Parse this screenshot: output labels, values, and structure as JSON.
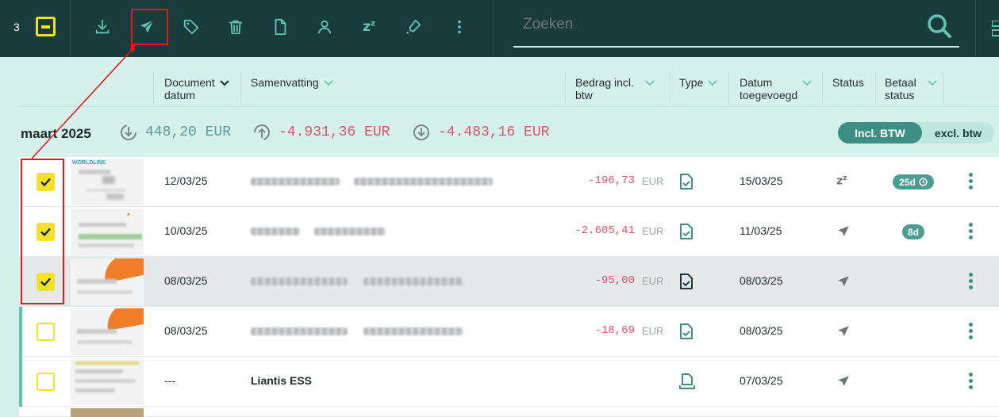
{
  "toolbar": {
    "selected_count": "3",
    "zz_label": "z",
    "zz_sup": "z",
    "search_placeholder": "Zoeken",
    "icons": [
      "checkbox-indeterminate-icon",
      "download-icon",
      "send-icon",
      "tag-icon",
      "trash-icon",
      "file-icon",
      "assign-user-icon",
      "snooze-icon",
      "marker-icon",
      "more-vertical-icon",
      "search-icon"
    ]
  },
  "columns": {
    "doc_date_1": "Document",
    "doc_date_2": "datum",
    "summary": "Samenvatting",
    "amount_1": "Bedrag incl.",
    "amount_2": "btw",
    "type": "Type",
    "added_1": "Datum",
    "added_2": "toegevoegd",
    "status": "Status",
    "pay_1": "Betaal",
    "pay_2": "status"
  },
  "month": {
    "label": "maart 2025",
    "income": "448,20 EUR",
    "expense": "-4.931,36 EUR",
    "balance": "-4.483,16 EUR"
  },
  "colors": {
    "income": "#5a9d95",
    "expense": "#e0506a",
    "accent": "#3d8f85",
    "yellow": "#f5e12a"
  },
  "vat_toggle": {
    "incl": "Incl. BTW",
    "excl": "excl. btw"
  },
  "rows": [
    {
      "checked": true,
      "doc_date": "12/03/25",
      "summary": "",
      "amount": "-196,73",
      "currency": "EUR",
      "added": "15/03/25",
      "status_icon": "snooze-icon",
      "badge": "25d"
    },
    {
      "checked": true,
      "doc_date": "10/03/25",
      "summary": "",
      "amount": "-2.605,41",
      "currency": "EUR",
      "added": "11/03/25",
      "status_icon": "send-icon",
      "badge": "8d"
    },
    {
      "checked": true,
      "doc_date": "08/03/25",
      "summary": "",
      "amount": "-95,00",
      "currency": "EUR",
      "added": "08/03/25",
      "status_icon": "send-icon",
      "badge": ""
    },
    {
      "checked": false,
      "doc_date": "08/03/25",
      "summary": "",
      "amount": "-18,69",
      "currency": "EUR",
      "added": "08/03/25",
      "status_icon": "send-icon",
      "badge": ""
    },
    {
      "checked": false,
      "doc_date": "---",
      "summary": "Liantis ESS",
      "amount": "",
      "currency": "",
      "added": "07/03/25",
      "status_icon": "send-icon",
      "badge": ""
    }
  ]
}
